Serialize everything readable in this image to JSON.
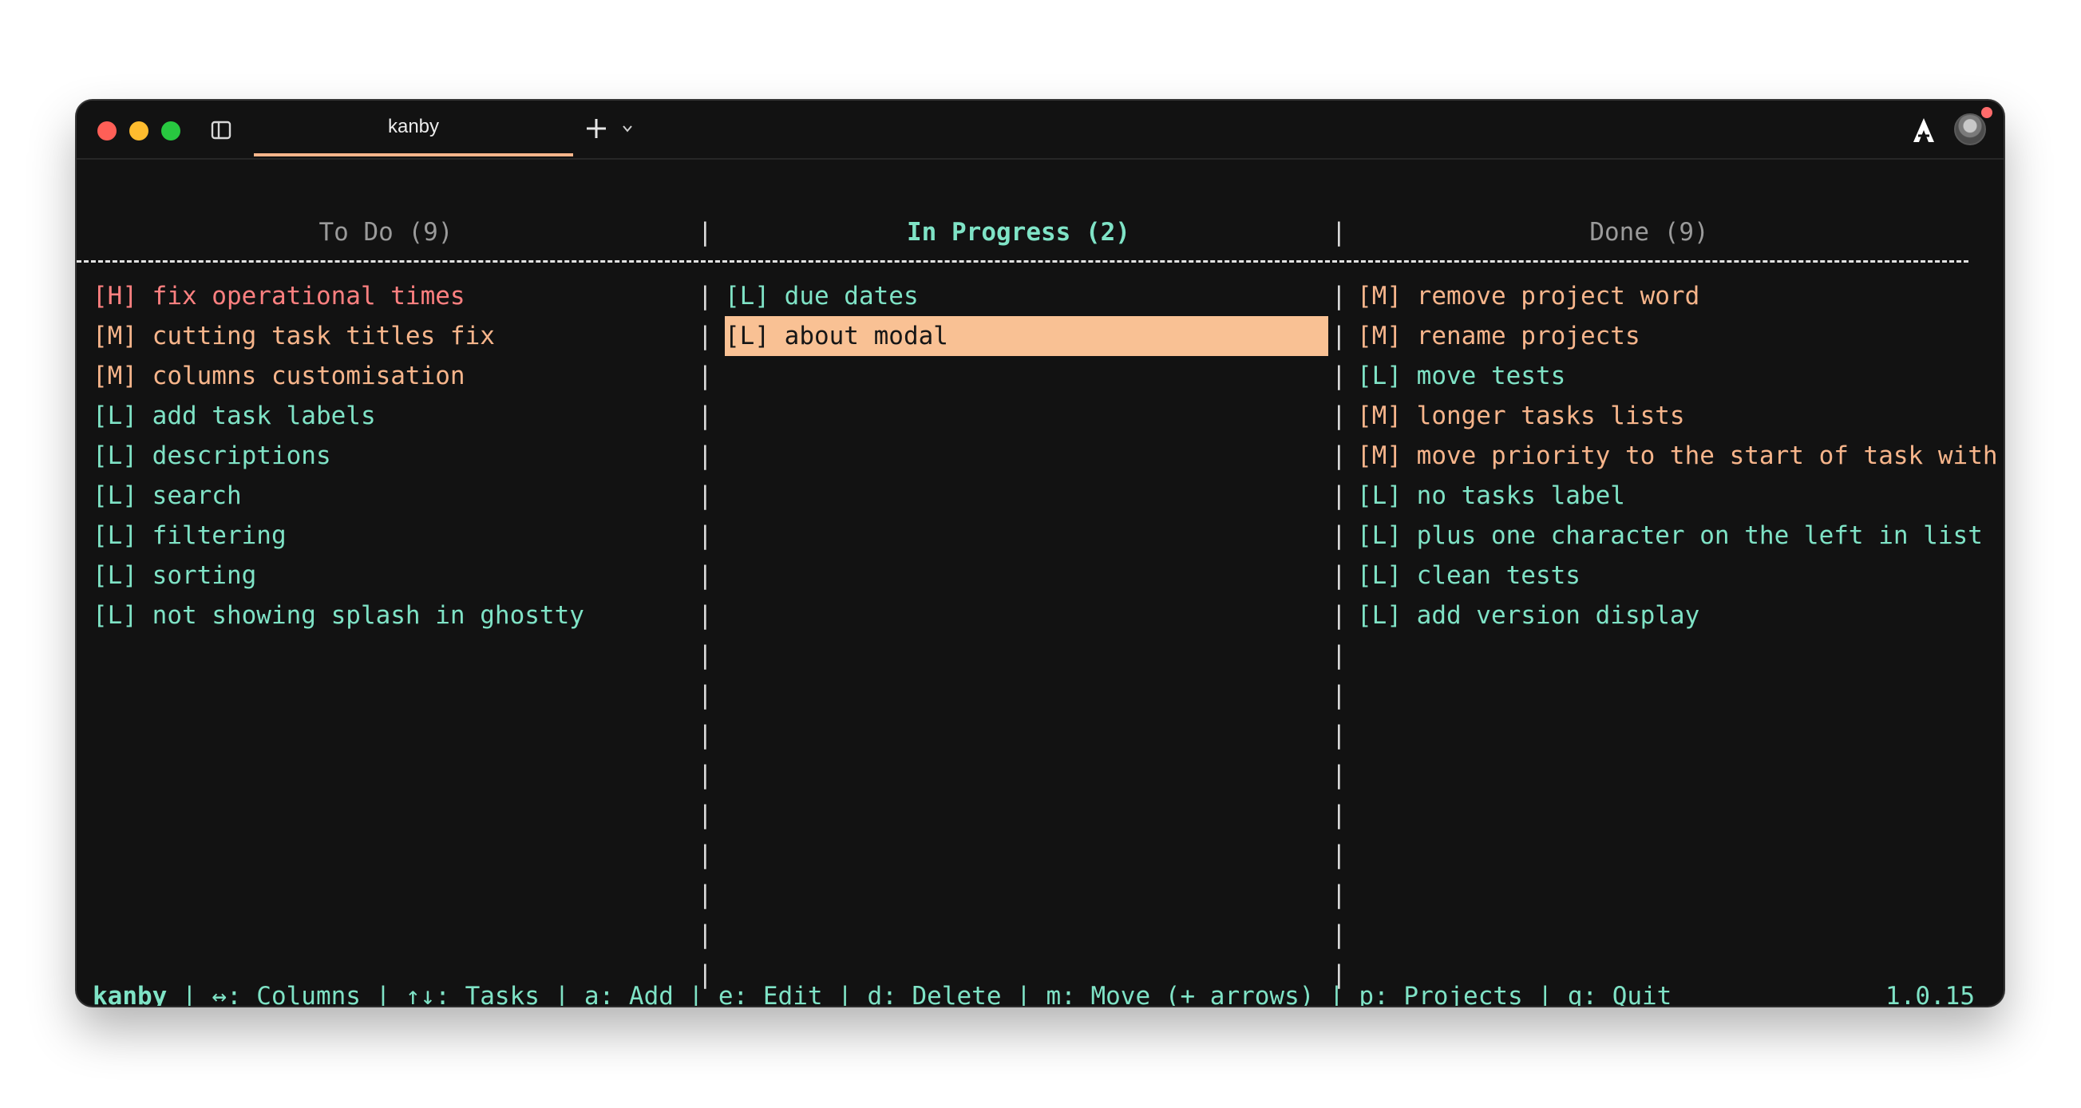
{
  "window": {
    "tab_title": "kanby"
  },
  "columns": [
    {
      "header": "To Do (9)",
      "active": false,
      "tasks": [
        {
          "priority": "H",
          "label": "[H] fix operational times"
        },
        {
          "priority": "M",
          "label": "[M] cutting task titles fix"
        },
        {
          "priority": "M",
          "label": "[M] columns customisation"
        },
        {
          "priority": "L",
          "label": "[L] add task labels"
        },
        {
          "priority": "L",
          "label": "[L] descriptions"
        },
        {
          "priority": "L",
          "label": "[L] search"
        },
        {
          "priority": "L",
          "label": "[L] filtering"
        },
        {
          "priority": "L",
          "label": "[L] sorting"
        },
        {
          "priority": "L",
          "label": "[L] not showing splash in ghostty"
        }
      ]
    },
    {
      "header": "In Progress (2)",
      "active": true,
      "tasks": [
        {
          "priority": "L",
          "label": "[L] due dates"
        },
        {
          "priority": "L",
          "label": "[L] about modal",
          "selected": true
        }
      ]
    },
    {
      "header": "Done (9)",
      "active": false,
      "tasks": [
        {
          "priority": "M",
          "label": "[M] remove project word"
        },
        {
          "priority": "M",
          "label": "[M] rename projects"
        },
        {
          "priority": "L",
          "label": "[L] move tests"
        },
        {
          "priority": "M",
          "label": "[M] longer tasks lists"
        },
        {
          "priority": "M",
          "label": "[M] move priority to the start of task with"
        },
        {
          "priority": "L",
          "label": "[L] no tasks label"
        },
        {
          "priority": "L",
          "label": "[L] plus one character on the left in list"
        },
        {
          "priority": "L",
          "label": "[L] clean tests"
        },
        {
          "priority": "L",
          "label": "[L] add version display"
        }
      ]
    }
  ],
  "colors": {
    "high": "#ff8080",
    "medium": "#f7b58b",
    "low": "#7fe3c6",
    "selection": "#f9c194",
    "background": "#121212"
  },
  "status_bar": {
    "app_name": "kanby",
    "keybindings": " | ↔: Columns | ↑↓: Tasks | a: Add | e: Edit | d: Delete | m: Move (+ arrows) | p: Projects | q: Quit",
    "version": "1.0.15"
  },
  "icons": [
    "close-light",
    "minimize-light",
    "zoom-light",
    "sidebar-toggle-icon",
    "plus-icon",
    "chevron-down-icon",
    "brand-icon",
    "avatar"
  ]
}
